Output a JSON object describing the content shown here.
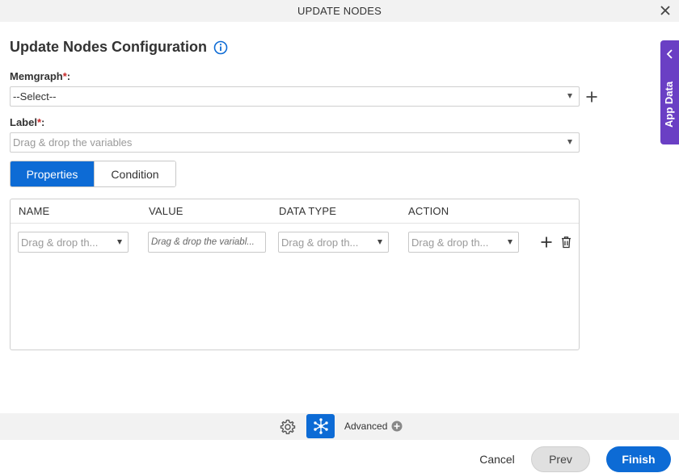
{
  "window": {
    "title": "UPDATE NODES"
  },
  "heading": {
    "title": "Update Nodes Configuration"
  },
  "memgraph": {
    "label": "Memgraph",
    "required_mark": "*",
    "suffix": ":",
    "value": "--Select--"
  },
  "label_field": {
    "label": "Label",
    "required_mark": "*",
    "suffix": ":",
    "placeholder": "Drag & drop the variables"
  },
  "tabs": [
    {
      "label": "Properties",
      "active": true
    },
    {
      "label": "Condition",
      "active": false
    }
  ],
  "table": {
    "columns": [
      "NAME",
      "VALUE",
      "DATA TYPE",
      "ACTION"
    ],
    "row": {
      "name_placeholder": "Drag & drop th...",
      "value_placeholder": "Drag & drop the variabl...",
      "datatype_placeholder": "Drag & drop th...",
      "action_placeholder": "Drag & drop th..."
    }
  },
  "side_panel": {
    "label": "App Data"
  },
  "toolbar": {
    "advanced_label": "Advanced"
  },
  "footer": {
    "cancel": "Cancel",
    "prev": "Prev",
    "finish": "Finish"
  },
  "colors": {
    "primary": "#0d6bd5",
    "app_data": "#6a3fc4",
    "required": "#c62828"
  }
}
